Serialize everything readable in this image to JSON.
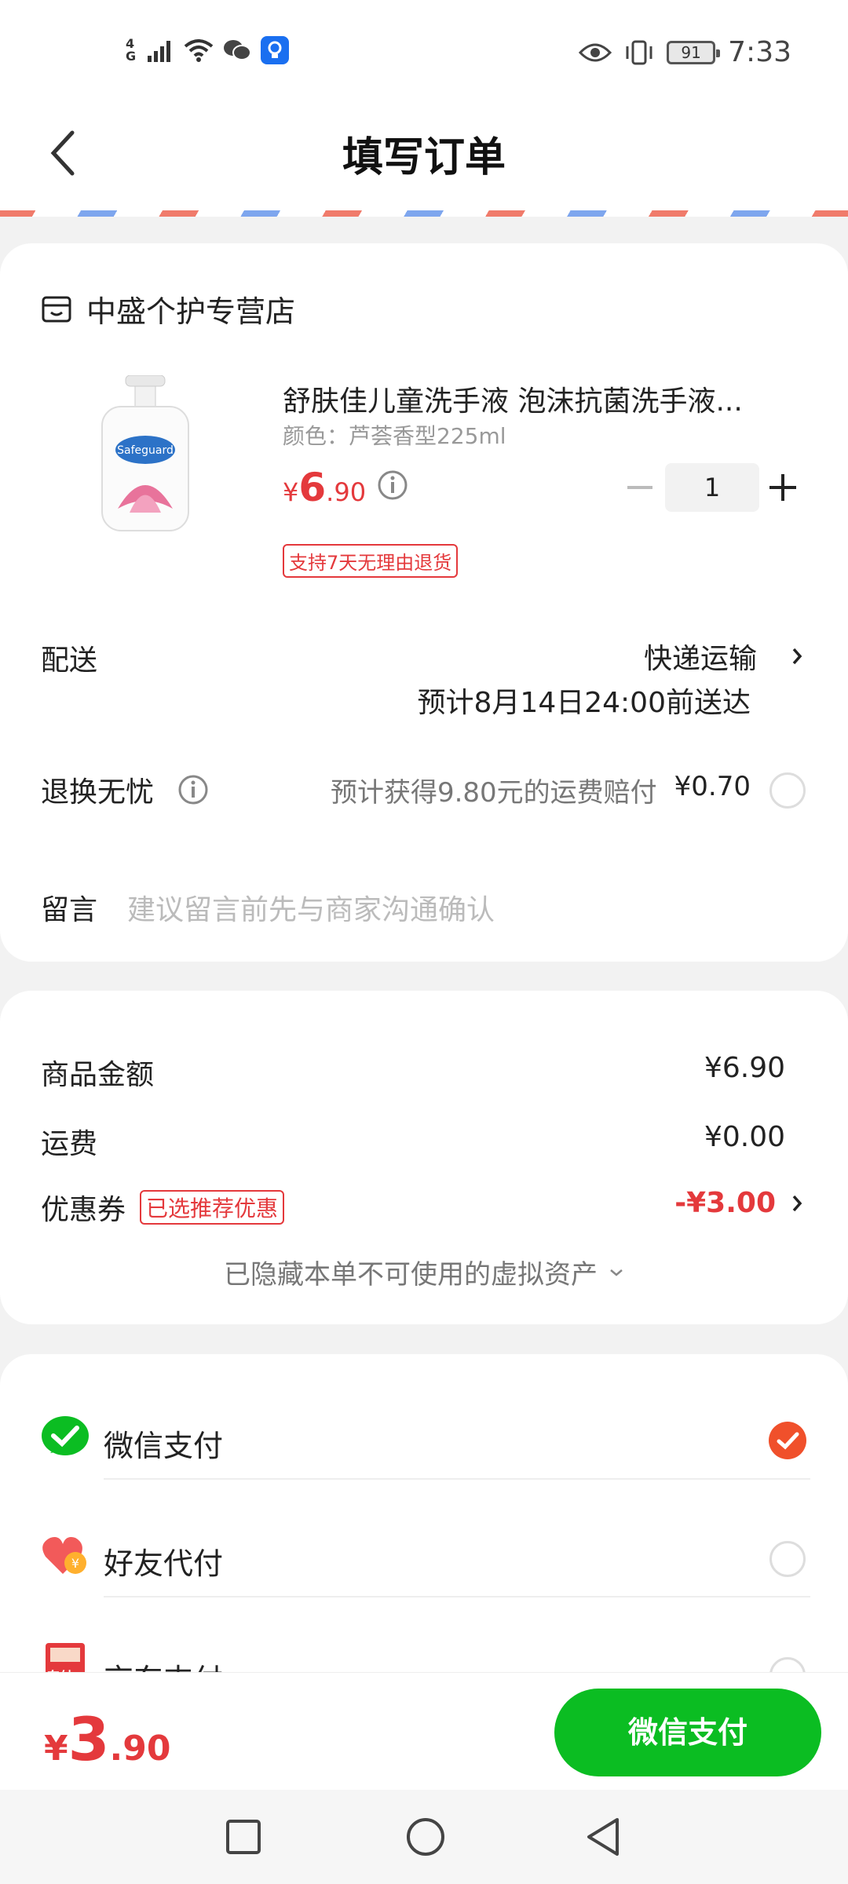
{
  "status_bar": {
    "network": "4G",
    "time": "7:33",
    "battery": "91"
  },
  "header": {
    "title": "填写订单"
  },
  "store": {
    "name": "中盛个护专营店"
  },
  "product": {
    "name": "舒肤佳儿童洗手液 泡沫抗菌洗手液...",
    "spec": "颜色：芦荟香型225ml",
    "price_symbol": "¥",
    "price_int": "6",
    "price_dec": ".90",
    "quantity": "1",
    "return_tag": "支持7天无理由退货"
  },
  "delivery": {
    "label": "配送",
    "method": "快递运输",
    "eta": "预计8月14日24:00前送达"
  },
  "return_ins": {
    "label": "退换无忧",
    "desc": "预计获得9.80元的运费赔付",
    "price": "¥0.70"
  },
  "message": {
    "label": "留言",
    "placeholder": "建议留言前先与商家沟通确认"
  },
  "summary": {
    "goods_label": "商品金额",
    "goods_value": "¥6.90",
    "shipping_label": "运费",
    "shipping_value": "¥0.00",
    "coupon_label": "优惠券",
    "coupon_tag": "已选推荐优惠",
    "coupon_value": "-¥3.00",
    "hidden_assets": "已隐藏本单不可使用的虚拟资产"
  },
  "payment": {
    "options": [
      {
        "label": "微信支付",
        "selected": true
      },
      {
        "label": "好友代付",
        "selected": false
      },
      {
        "label": "京东支付",
        "selected": false
      }
    ],
    "jd_icon_text": "东付"
  },
  "footer": {
    "total_symbol": "¥",
    "total_int": "3",
    "total_dec": ".90",
    "pay_button": "微信支付"
  },
  "colors": {
    "accent_red": "#e4393c",
    "wechat_green": "#0bbd22",
    "check_orange": "#f0502b"
  }
}
